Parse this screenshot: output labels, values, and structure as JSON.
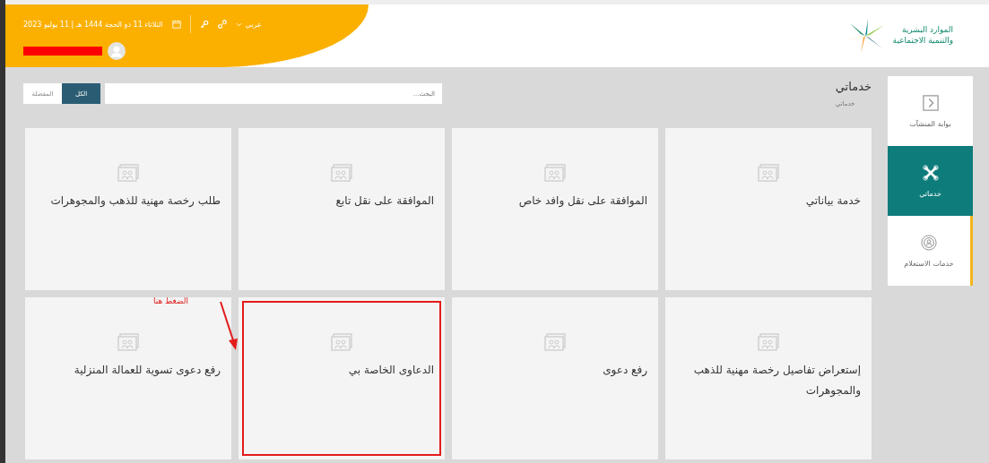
{
  "header": {
    "date": "الثلاثاء 11 ذو الحجة 1444 هـ | 11 يوليو 2023",
    "language": "عربي",
    "logo_text": [
      "الموارد البشرية",
      "والتنمية الاجتماعية"
    ]
  },
  "sidebar": {
    "items": [
      {
        "label": "بوابة المنشآت",
        "kind": "portal",
        "selected": false
      },
      {
        "label": "خدماتي",
        "kind": "tools",
        "selected": true
      },
      {
        "label": "خدمات الاستعلام",
        "kind": "inquiry",
        "selected": false
      }
    ]
  },
  "page": {
    "title": "خدماتي",
    "breadcrumb": "خدماتي"
  },
  "search": {
    "placeholder": "البحث..."
  },
  "filters": [
    {
      "label": "الكل",
      "selected": true
    },
    {
      "label": "المفضلة",
      "selected": false
    }
  ],
  "services": [
    {
      "title": "خدمة بياناتي",
      "highlighted": false
    },
    {
      "title": "الموافقة على نقل وافد خاص",
      "highlighted": false
    },
    {
      "title": "الموافقة على نقل تابع",
      "highlighted": false
    },
    {
      "title": "طلب رخصة مهنية للذهب والمجوهرات",
      "highlighted": false
    },
    {
      "title": "إستعراض تفاصيل رخصة مهنية للذهب والمجوهرات",
      "highlighted": false
    },
    {
      "title": "رفع دعوى",
      "highlighted": false
    },
    {
      "title": "الدعاوى الخاصة بي",
      "highlighted": true
    },
    {
      "title": "رفع دعوى تسوية للعمالة المنزلية",
      "highlighted": false
    }
  ],
  "annotation": {
    "text": "الضغط هنا"
  }
}
